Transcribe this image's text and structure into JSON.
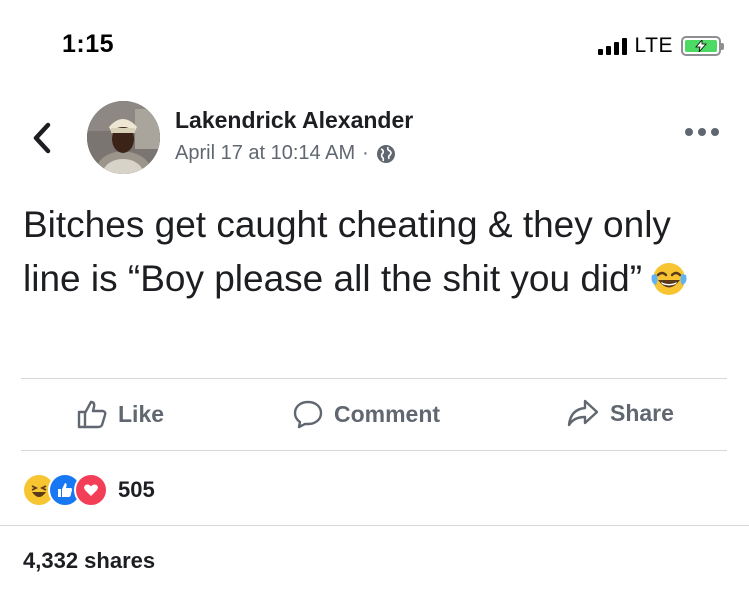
{
  "status_bar": {
    "time": "1:15",
    "network": "LTE",
    "signal_bars": 4,
    "battery_state": "charging",
    "battery_color": "#4cd964"
  },
  "header": {
    "back_icon": "chevron-left-icon",
    "author_name": "Lakendrick Alexander",
    "timestamp": "April 17 at 10:14 AM",
    "separator": "·",
    "audience_icon": "globe-icon",
    "more_icon": "ellipsis-icon"
  },
  "post": {
    "text": "Bitches get caught cheating & they only line is “Boy please all the shit you did”",
    "emoji": "face-with-tears-of-joy"
  },
  "actions": {
    "like_label": "Like",
    "comment_label": "Comment",
    "share_label": "Share"
  },
  "reactions": {
    "types": [
      "haha",
      "like",
      "love"
    ],
    "count": "505"
  },
  "shares_label": "4,332 shares",
  "colors": {
    "text_primary": "#1c1e21",
    "text_secondary": "#606770",
    "divider": "#d5d7da",
    "like_blue": "#1877f2",
    "love_red": "#f33e58",
    "haha_yellow": "#f7c531"
  }
}
